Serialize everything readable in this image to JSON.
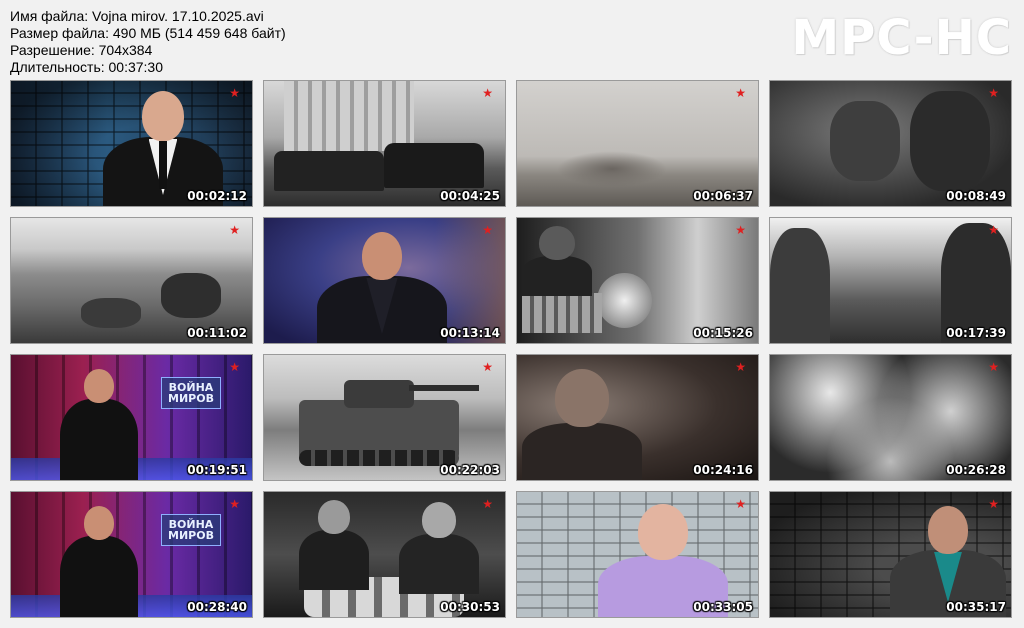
{
  "info": {
    "filename": "Имя файла: Vojna mirov. 17.10.2025.avi",
    "filesize": "Размер файла: 490 МБ (514 459 648 байт)",
    "resolution": "Разрешение: 704x384",
    "duration": "Длительность: 00:37:30"
  },
  "logo": "MPC-HC",
  "channel_mark": "★",
  "studio_logo": "ВОЙНА МИРОВ",
  "thumbnails": [
    {
      "time": "00:02:12",
      "scene": "host-blue-bricks"
    },
    {
      "time": "00:04:25",
      "scene": "archive-cars"
    },
    {
      "time": "00:06:37",
      "scene": "archive-field"
    },
    {
      "time": "00:08:49",
      "scene": "archive-soldiers"
    },
    {
      "time": "00:11:02",
      "scene": "archive-battlefield"
    },
    {
      "time": "00:13:14",
      "scene": "host-blue"
    },
    {
      "time": "00:15:26",
      "scene": "archive-lathe"
    },
    {
      "time": "00:17:39",
      "scene": "archive-forest"
    },
    {
      "time": "00:19:51",
      "scene": "studio-host"
    },
    {
      "time": "00:22:03",
      "scene": "archive-tank"
    },
    {
      "time": "00:24:16",
      "scene": "archive-worker"
    },
    {
      "time": "00:26:28",
      "scene": "archive-smoke"
    },
    {
      "time": "00:28:40",
      "scene": "studio-host"
    },
    {
      "time": "00:30:53",
      "scene": "archive-factory"
    },
    {
      "time": "00:33:05",
      "scene": "expert-bricks"
    },
    {
      "time": "00:35:17",
      "scene": "expert-dark-bricks"
    }
  ]
}
